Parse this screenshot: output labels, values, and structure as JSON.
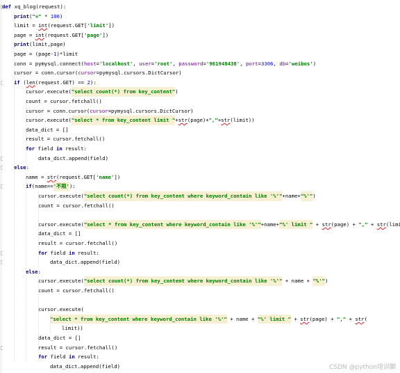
{
  "editor": {
    "lines": [
      {
        "indent": 0,
        "segs": [
          [
            "def",
            "kw"
          ],
          [
            " xq_blog(request):",
            ""
          ]
        ]
      },
      {
        "indent": 1,
        "segs": [
          [
            "print",
            "kw"
          ],
          [
            "(",
            ""
          ],
          [
            "\"=\"",
            "str"
          ],
          [
            " * ",
            ""
          ],
          [
            "100",
            "num"
          ],
          [
            ")",
            ""
          ]
        ]
      },
      {
        "indent": 1,
        "segs": [
          [
            "limit = ",
            ""
          ],
          [
            "int",
            "u"
          ],
          [
            "(request.GET[",
            ""
          ],
          [
            "'limit'",
            "str"
          ],
          [
            "])",
            ""
          ]
        ]
      },
      {
        "indent": 1,
        "segs": [
          [
            "page = ",
            ""
          ],
          [
            "int",
            "u"
          ],
          [
            "(request.GET[",
            ""
          ],
          [
            "'page'",
            "str"
          ],
          [
            "])",
            ""
          ]
        ]
      },
      {
        "indent": 1,
        "segs": [
          [
            "print",
            "kw"
          ],
          [
            "(limit,page)",
            ""
          ]
        ]
      },
      {
        "indent": 1,
        "segs": [
          [
            "page = (page-",
            ""
          ],
          [
            "1",
            "num"
          ],
          [
            ")*limit",
            ""
          ]
        ]
      },
      {
        "indent": 1,
        "segs": [
          [
            "conn = pymysql.connect(",
            ""
          ],
          [
            "host",
            "kwarg"
          ],
          [
            "=",
            ""
          ],
          [
            "'localhost'",
            "str"
          ],
          [
            ", ",
            ""
          ],
          [
            "user",
            "kwarg"
          ],
          [
            "=",
            ""
          ],
          [
            "'root'",
            "str"
          ],
          [
            ", ",
            ""
          ],
          [
            "password",
            "kwarg"
          ],
          [
            "=",
            ""
          ],
          [
            "'961948438'",
            "str"
          ],
          [
            ", ",
            ""
          ],
          [
            "port",
            "kwarg"
          ],
          [
            "=",
            ""
          ],
          [
            "3306",
            "num"
          ],
          [
            ", ",
            ""
          ],
          [
            "db",
            "kwarg"
          ],
          [
            "=",
            ""
          ],
          [
            "'weibos'",
            "str"
          ],
          [
            ")",
            ""
          ]
        ]
      },
      {
        "indent": 1,
        "segs": [
          [
            "cursor = conn.cursor(",
            ""
          ],
          [
            "cursor",
            "kwarg"
          ],
          [
            "=pymysql.cursors.DictCursor)",
            ""
          ]
        ]
      },
      {
        "indent": 1,
        "segs": [
          [
            "if",
            "kw"
          ],
          [
            " (",
            ""
          ],
          [
            "len",
            "u"
          ],
          [
            "(request.GET) == ",
            ""
          ],
          [
            "2",
            "num"
          ],
          [
            "):",
            ""
          ]
        ]
      },
      {
        "indent": 2,
        "segs": [
          [
            "cursor.execute(",
            ""
          ],
          [
            "\"select count(*) from key_content\"",
            "str hl"
          ],
          [
            ")",
            ""
          ]
        ]
      },
      {
        "indent": 2,
        "segs": [
          [
            "count = cursor.fetchall()",
            ""
          ]
        ]
      },
      {
        "indent": 2,
        "segs": [
          [
            "cursor = conn.cursor(",
            ""
          ],
          [
            "cursor",
            "kwarg"
          ],
          [
            "=pymysql.cursors.DictCursor)",
            ""
          ]
        ]
      },
      {
        "indent": 2,
        "segs": [
          [
            "cursor.execute(",
            ""
          ],
          [
            "\"select * from key_content limit \"",
            "str hl"
          ],
          [
            "+",
            ""
          ],
          [
            "str",
            "u"
          ],
          [
            "(page)+",
            ""
          ],
          [
            "\",\"",
            "str"
          ],
          [
            "+",
            ""
          ],
          [
            "str",
            "u"
          ],
          [
            "(limit))",
            ""
          ]
        ]
      },
      {
        "indent": 2,
        "segs": [
          [
            "data_dict = []",
            ""
          ]
        ]
      },
      {
        "indent": 2,
        "segs": [
          [
            "result = cursor.fetchall()",
            ""
          ]
        ]
      },
      {
        "indent": 2,
        "segs": [
          [
            "for",
            "kw"
          ],
          [
            " field ",
            ""
          ],
          [
            "in",
            "kw"
          ],
          [
            " result:",
            ""
          ]
        ]
      },
      {
        "indent": 3,
        "segs": [
          [
            "data_dict.append(field)",
            ""
          ]
        ]
      },
      {
        "indent": 1,
        "segs": [
          [
            "else",
            "kw"
          ],
          [
            ":",
            ""
          ]
        ]
      },
      {
        "indent": 2,
        "segs": [
          [
            "name = ",
            ""
          ],
          [
            "str",
            "u"
          ],
          [
            "(request.GET[",
            ""
          ],
          [
            "'name'",
            "str"
          ],
          [
            "])",
            ""
          ]
        ]
      },
      {
        "indent": 2,
        "segs": [
          [
            "if",
            "kw"
          ],
          [
            "(name==",
            ""
          ],
          [
            "'不限'",
            "str hl"
          ],
          [
            "):",
            ""
          ]
        ]
      },
      {
        "indent": 3,
        "segs": [
          [
            "cursor.execute(",
            ""
          ],
          [
            "\"select count(*) from key_content where keyword_contain like '%'\"",
            "str hl"
          ],
          [
            "+name+",
            ""
          ],
          [
            "\"%'\"",
            "str hl"
          ],
          [
            ")",
            ""
          ]
        ]
      },
      {
        "indent": 3,
        "segs": [
          [
            "count = cursor.fetchall()",
            ""
          ]
        ]
      },
      {
        "indent": 0,
        "segs": []
      },
      {
        "indent": 3,
        "segs": [
          [
            "cursor.execute(",
            ""
          ],
          [
            "\"select * from key_content where keyword_contain like '%'\"",
            "str hl"
          ],
          [
            "+name+",
            ""
          ],
          [
            "\"%' limit \"",
            "str hl"
          ],
          [
            " + ",
            ""
          ],
          [
            "str",
            "u"
          ],
          [
            "(page) + ",
            ""
          ],
          [
            "\",\"",
            "str"
          ],
          [
            " + ",
            ""
          ],
          [
            "str",
            "u"
          ],
          [
            "(limit))",
            ""
          ]
        ]
      },
      {
        "indent": 3,
        "segs": [
          [
            "data_dict = []",
            ""
          ]
        ]
      },
      {
        "indent": 3,
        "segs": [
          [
            "result = cursor.fetchall()",
            ""
          ]
        ]
      },
      {
        "indent": 3,
        "segs": [
          [
            "for",
            "kw"
          ],
          [
            " field ",
            ""
          ],
          [
            "in",
            "kw"
          ],
          [
            " result:",
            ""
          ]
        ]
      },
      {
        "indent": 4,
        "segs": [
          [
            "data_dict.append(field)",
            ""
          ]
        ]
      },
      {
        "indent": 2,
        "segs": [
          [
            "else",
            "kw"
          ],
          [
            ":",
            ""
          ]
        ]
      },
      {
        "indent": 3,
        "segs": [
          [
            "cursor.execute(",
            ""
          ],
          [
            "\"select count(*) from key_content where keyword_contain like '%'\"",
            "str hl"
          ],
          [
            " + name + ",
            ""
          ],
          [
            "\"%'\"",
            "str hl"
          ],
          [
            ")",
            ""
          ]
        ]
      },
      {
        "indent": 3,
        "segs": [
          [
            "count = cursor.fetchall()",
            ""
          ]
        ]
      },
      {
        "indent": 0,
        "segs": []
      },
      {
        "indent": 3,
        "segs": [
          [
            "cursor.execute(",
            ""
          ]
        ]
      },
      {
        "indent": 4,
        "segs": [
          [
            "\"select * from key_content where keyword_contain like '%'\"",
            "str hl"
          ],
          [
            " + name + ",
            ""
          ],
          [
            "\"%' limit \"",
            "str hl"
          ],
          [
            " + ",
            ""
          ],
          [
            "str",
            "u"
          ],
          [
            "(page) + ",
            ""
          ],
          [
            "\",\"",
            "str"
          ],
          [
            " + ",
            ""
          ],
          [
            "str",
            "u"
          ],
          [
            "(",
            ""
          ]
        ]
      },
      {
        "indent": 5,
        "segs": [
          [
            "limit))",
            ""
          ]
        ]
      },
      {
        "indent": 3,
        "segs": [
          [
            "data_dict = []",
            ""
          ]
        ]
      },
      {
        "indent": 3,
        "segs": [
          [
            "result = cursor.fetchall()",
            ""
          ]
        ]
      },
      {
        "indent": 3,
        "segs": [
          [
            "for",
            "kw"
          ],
          [
            " field ",
            ""
          ],
          [
            "in",
            "kw"
          ],
          [
            " result:",
            ""
          ]
        ]
      },
      {
        "indent": 4,
        "segs": [
          [
            "data_dict.append(field)",
            ""
          ]
        ]
      }
    ]
  },
  "watermark": "CSDN @python培训獅"
}
